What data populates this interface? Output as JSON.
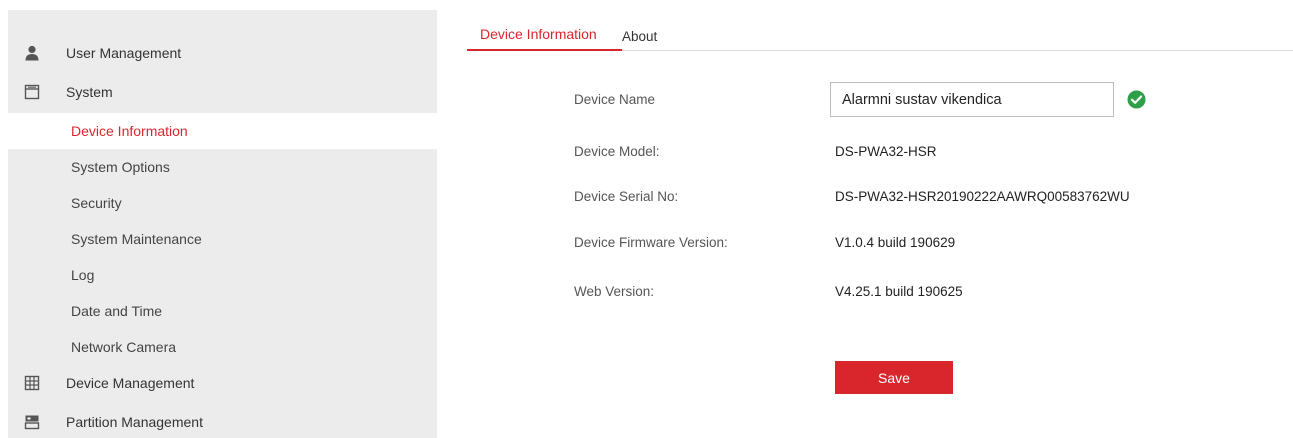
{
  "sidebar": {
    "sections": [
      {
        "label": "User Management",
        "icon": "user-icon"
      },
      {
        "label": "System",
        "icon": "window-icon"
      },
      {
        "label": "Device Management",
        "icon": "device-grid-icon"
      },
      {
        "label": "Partition Management",
        "icon": "partition-icon"
      }
    ],
    "system_items": [
      {
        "label": "Device Information",
        "active": true
      },
      {
        "label": "System Options"
      },
      {
        "label": "Security"
      },
      {
        "label": "System Maintenance"
      },
      {
        "label": "Log"
      },
      {
        "label": "Date and Time"
      },
      {
        "label": "Network Camera"
      }
    ]
  },
  "tabs": [
    {
      "label": "Device Information",
      "active": true
    },
    {
      "label": "About"
    }
  ],
  "form": {
    "device_name": {
      "label": "Device Name",
      "value": "Alarmni sustav vikendica",
      "valid_icon": "check-circle-icon"
    },
    "fields": [
      {
        "label": "Device Model:",
        "value": "DS-PWA32-HSR"
      },
      {
        "label": "Device Serial No:",
        "value": "DS-PWA32-HSR20190222AAWRQ00583762WU"
      },
      {
        "label": "Device Firmware Version:",
        "value": "V1.0.4 build 190629"
      },
      {
        "label": "Web Version:",
        "value": "V4.25.1 build 190625"
      }
    ],
    "save_label": "Save"
  },
  "colors": {
    "accent": "#d9262c",
    "sidebar_bg": "#ececec",
    "valid": "#2e9e48"
  }
}
